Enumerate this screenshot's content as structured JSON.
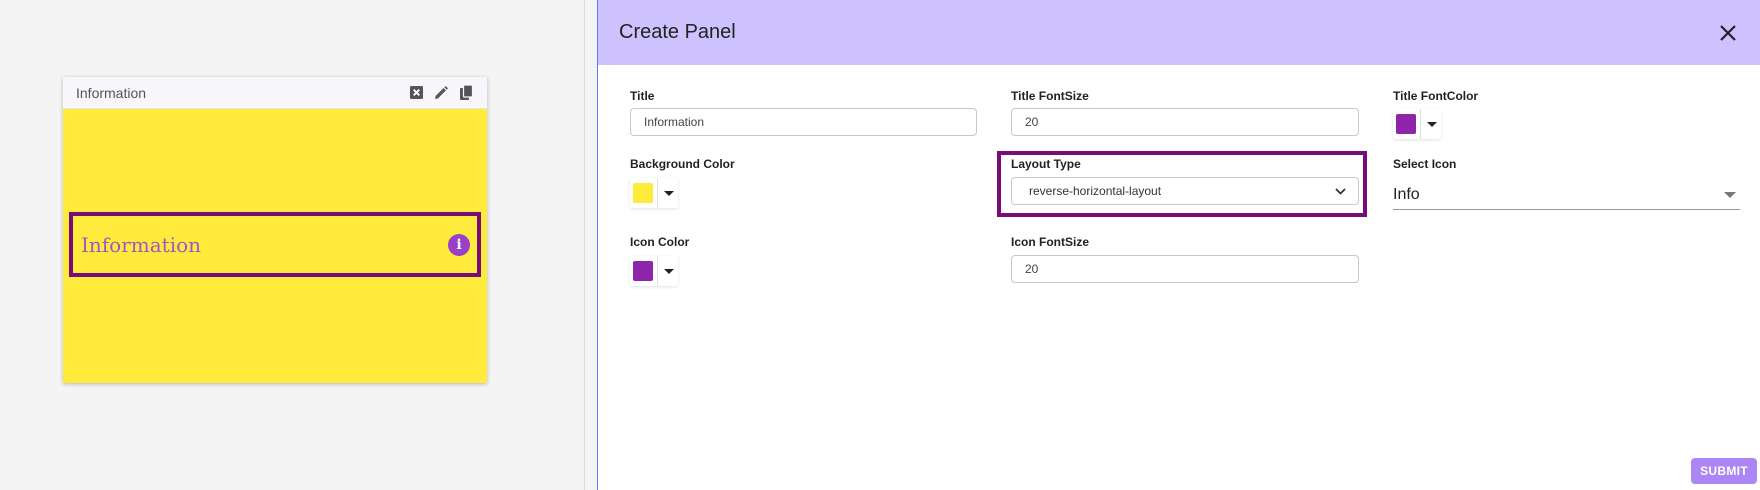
{
  "preview": {
    "card_title": "Information",
    "panel_title": "Information",
    "colors": {
      "background": "#ffeb3b",
      "title": "#a653c9",
      "icon": "#9c3fc7",
      "highlight": "#7a0b7a"
    },
    "actions": [
      "close-box-icon",
      "pencil-icon",
      "copy-icon"
    ],
    "info_glyph": "i"
  },
  "dialog": {
    "title": "Create Panel",
    "header_color": "#cdc2fd",
    "fields": {
      "title": {
        "label": "Title",
        "value": "Information"
      },
      "title_fontsize": {
        "label": "Title FontSize",
        "value": "20"
      },
      "title_fontcolor": {
        "label": "Title FontColor",
        "color": "#8e24aa"
      },
      "background_color": {
        "label": "Background Color",
        "color": "#ffeb3b"
      },
      "layout_type": {
        "label": "Layout Type",
        "value": "reverse-horizontal-layout"
      },
      "select_icon": {
        "label": "Select Icon",
        "value": "Info"
      },
      "icon_color": {
        "label": "Icon Color",
        "color": "#8e24aa"
      },
      "icon_fontsize": {
        "label": "Icon FontSize",
        "value": "20"
      }
    },
    "submit_label": "SUBMIT"
  }
}
